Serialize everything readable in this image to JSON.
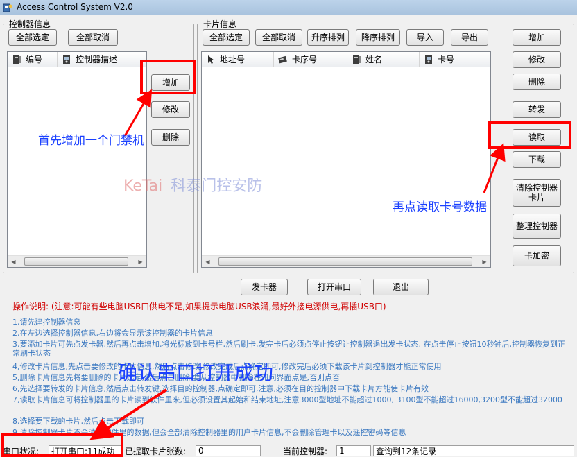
{
  "window": {
    "title": "Access Control System   V2.0"
  },
  "controller_panel": {
    "title": "控制器信息",
    "buttons": {
      "select_all": "全部选定",
      "deselect_all": "全部取消",
      "add": "增加",
      "modify": "修改",
      "delete": "删除"
    },
    "columns": [
      "编号",
      "控制器描述"
    ]
  },
  "card_panel": {
    "title": "卡片信息",
    "toolbar": {
      "select_all": "全部选定",
      "deselect_all": "全部取消",
      "sort_asc": "升序排列",
      "sort_desc": "降序排列",
      "import": "导入",
      "export": "导出"
    },
    "columns": [
      "地址号",
      "卡序号",
      "姓名",
      "卡号"
    ],
    "side_buttons": {
      "add": "增加",
      "modify": "修改",
      "delete": "删除",
      "forward": "转发",
      "read": "读取",
      "download": "下载",
      "clear_cards": "清除控制器卡片",
      "organize": "整理控制器",
      "encrypt": "卡加密"
    }
  },
  "bottom_buttons": {
    "card_issuer": "发卡器",
    "open_port": "打开串口",
    "exit": "退出"
  },
  "instructions": {
    "title": "操作说明:  (注意:可能有些电脑USB口供电不足,如果提示电脑USB浪涌,最好外接电源供电,再插USB口)",
    "lines": [
      "1,请先建控制器信息",
      "2,在左边选择控制器信息,右边将会显示该控制器的卡片信息",
      "3,要添加卡片可先点发卡器,然后再点击增加,将光标放到卡号栏,然后刷卡,发完卡后必须点停止按钮让控制器退出发卡状态,      在点击停止按钮10秒钟后,控制器恢复到正常刷卡状态",
      "4,修改卡片信息,先点击要修改的卡片信息,然后点击修改,修改完成后点确定即可,修改完后必须下载该卡片到控制器才能正常使用",
      "5,删除卡片信息先将要删除的卡片选定,然后点击删除,要从控制器中删除在讯问界面点是,否则点否",
      "6,先选择要转发的卡片信息,然后点击转发键,选择目的控制器,点确定即可,注意,必须在目的控制器中下载卡片方能使卡片有效",
      "7,读取卡片信息可将控制器里的卡片读到软件里来,但必须设置其起始和结束地址,注意3000型地址不能超过1000, 3100型不能超过16000,3200型不能超过32000",
      "8,选择要下载的卡片,然后点击下载即可",
      "9,清除控制器卡片不会清除软件里的数据,但会全部清除控制器里的用户卡片信息,不会删除管理卡以及遥控密码等信息"
    ]
  },
  "status_bar": {
    "port_label": "串口状况:",
    "port_value": "打开串口:11成功",
    "cards_label": "已提取卡片张数:",
    "cards_value": "0",
    "controller_label": "当前控制器:",
    "controller_value": "1",
    "query_value": "查询到12条记录"
  },
  "annotations": {
    "add_controller": "首先增加一个门禁机",
    "read_cards": "再点读取卡号数据",
    "confirm_port": "确认串口打开成功",
    "watermark_en": "KeTai",
    "watermark_cn": "科泰门控安防"
  },
  "colors": {
    "highlight_red": "#ff0000",
    "annotation_blue": "#1a40ff",
    "instruction_blue": "#3a78c0",
    "warning_red": "#d00000"
  }
}
